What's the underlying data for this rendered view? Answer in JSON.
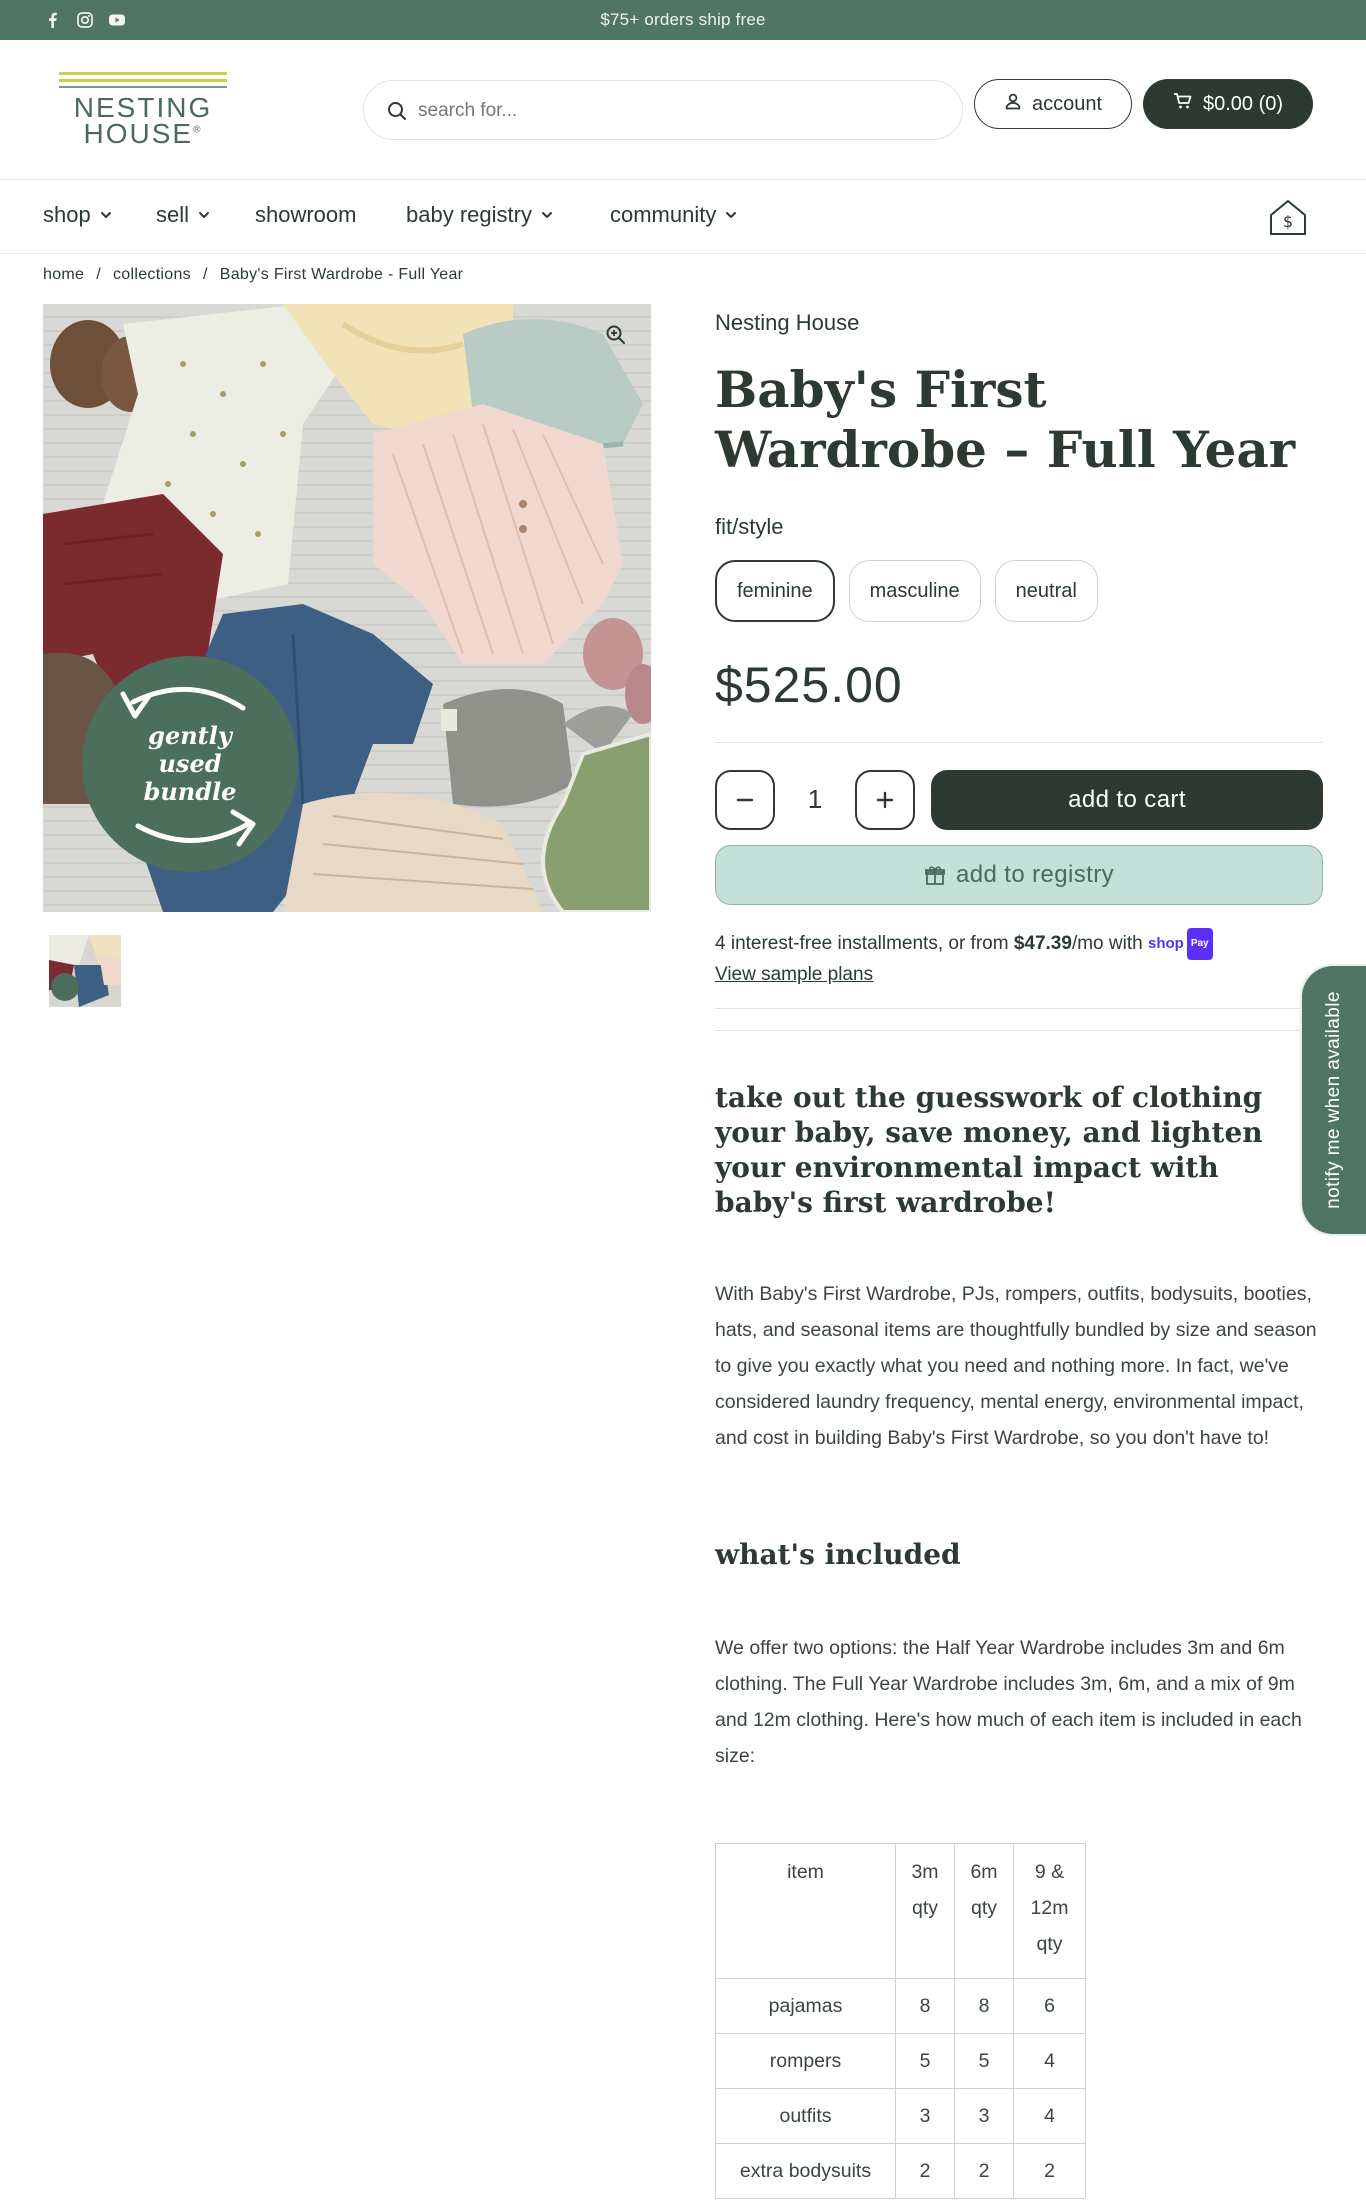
{
  "announcement": {
    "message": "$75+ orders ship free",
    "socials": [
      "facebook-icon",
      "instagram-icon",
      "youtube-icon"
    ]
  },
  "header": {
    "logo_line1": "NESTING",
    "logo_line2": "HOUSE",
    "logo_mark": "®",
    "search_placeholder": "search for...",
    "account_label": "account",
    "cart_label": "$0.00 (0)"
  },
  "nav": {
    "items": [
      {
        "label": "shop",
        "dropdown": true
      },
      {
        "label": "sell",
        "dropdown": true
      },
      {
        "label": "showroom",
        "dropdown": false
      },
      {
        "label": "baby registry",
        "dropdown": true
      },
      {
        "label": "community",
        "dropdown": true
      }
    ]
  },
  "breadcrumb": [
    "home",
    "collections",
    "Baby's First Wardrobe - Full Year"
  ],
  "breadcrumb_sep": "/",
  "product": {
    "vendor": "Nesting House",
    "title": "Baby's First Wardrobe – Full Year",
    "badge_lines": [
      "gently",
      "used",
      "bundle"
    ],
    "option_label": "fit/style",
    "options": [
      "feminine",
      "masculine",
      "neutral"
    ],
    "selected_option": "feminine",
    "price": "$525.00",
    "quantity": "1",
    "add_to_cart_label": "add to cart",
    "add_to_registry_label": "add to registry",
    "installments_prefix": "4 interest-free installments, or from ",
    "installments_amount": "$47.39",
    "installments_suffix": "/mo with ",
    "shoppay_label": "shop",
    "shoppay_pay": "Pay",
    "sample_plans_label": "View sample plans"
  },
  "description": {
    "headline": "take out the guesswork of clothing your baby, save money, and lighten your environmental impact with baby's first wardrobe!",
    "intro": "With Baby's First Wardrobe, PJs, rompers, outfits, bodysuits, booties, hats, and seasonal items are thoughtfully bundled by size and season to give you exactly what you need and nothing more. In fact, we've considered laundry frequency, mental energy, environmental impact, and cost in building Baby's First Wardrobe, so you don't have to!",
    "included_heading": "what's included",
    "included_text": "We offer two options: the Half Year Wardrobe includes 3m and 6m clothing. The Full Year Wardrobe includes 3m, 6m, and a mix of 9m and 12m clothing. Here's how much of each item is included in each size:"
  },
  "table": {
    "headers": [
      "item",
      "3m qty",
      "6m qty",
      "9 & 12m qty"
    ],
    "rows": [
      [
        "pajamas",
        "8",
        "8",
        "6"
      ],
      [
        "rompers",
        "5",
        "5",
        "4"
      ],
      [
        "outfits",
        "3",
        "3",
        "4"
      ],
      [
        "extra bodysuits",
        "2",
        "2",
        "2"
      ]
    ]
  },
  "notify_label": "notify me when available",
  "colors": {
    "brand_green": "#4f7564",
    "dark": "#2c3a32",
    "registry_bg": "#c4e0d8",
    "logo_accent": "#c7d44a"
  }
}
